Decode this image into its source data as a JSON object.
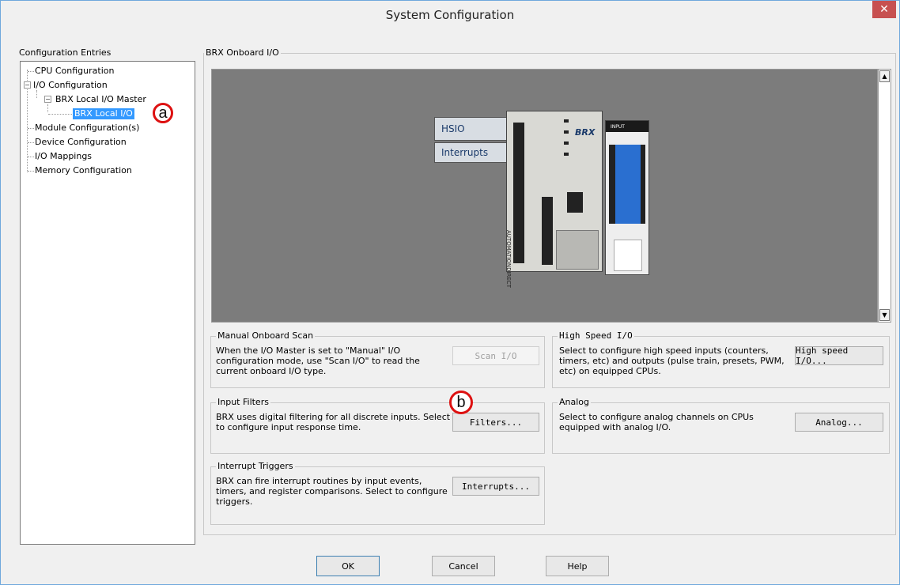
{
  "window": {
    "title": "System Configuration",
    "close_glyph": "✕"
  },
  "tree": {
    "label": "Configuration Entries",
    "items": [
      {
        "label": "CPU Configuration"
      },
      {
        "label": "I/O Configuration"
      },
      {
        "label": "BRX Local I/O Master"
      },
      {
        "label": "BRX Local I/O"
      },
      {
        "label": "Module Configuration(s)"
      },
      {
        "label": "Device Configuration"
      },
      {
        "label": "I/O Mappings"
      },
      {
        "label": "Memory Configuration"
      }
    ]
  },
  "callouts": {
    "a": "a",
    "b": "b"
  },
  "onboard": {
    "label": "BRX Onboard I/O",
    "tabs": [
      "HSIO",
      "Interrupts"
    ],
    "module_label": "INPUT",
    "brand": "AUTOMATIONDIRECT",
    "cpu_logo": "BRX"
  },
  "manual_scan": {
    "label": "Manual Onboard Scan",
    "text": "When the I/O Master is set to \"Manual\" I/O configuration mode, use \"Scan I/O\" to read the current onboard I/O type.",
    "button": "Scan I/O"
  },
  "high_speed": {
    "label": "High Speed I/O",
    "text": "Select to configure high speed inputs (counters, timers, etc) and outputs (pulse train, presets, PWM, etc) on equipped CPUs.",
    "button": "High speed I/O..."
  },
  "input_filters": {
    "label": "Input Filters",
    "text": "BRX uses digital filtering for all discrete inputs. Select to configure input response time.",
    "button": "Filters..."
  },
  "analog": {
    "label": "Analog",
    "text": "Select to configure analog channels on CPUs equipped with analog I/O.",
    "button": "Analog..."
  },
  "interrupt_triggers": {
    "label": "Interrupt Triggers",
    "text": "BRX can fire interrupt routines by input events, timers, and register comparisons. Select to configure triggers.",
    "button": "Interrupts..."
  },
  "footer": {
    "ok": "OK",
    "cancel": "Cancel",
    "help": "Help"
  }
}
